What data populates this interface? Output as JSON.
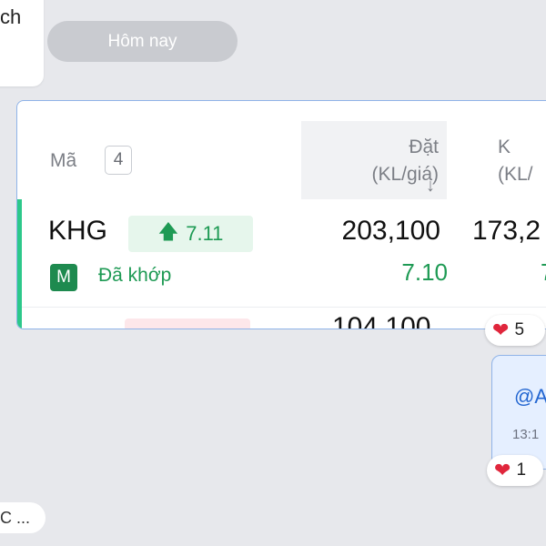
{
  "chat": {
    "top_left_text": "ch",
    "date_divider": "Hôm nay",
    "bottom_left_text": "C ..."
  },
  "orders_card": {
    "header": {
      "symbol_label": "Mã",
      "count": "4",
      "order_col_line1": "Đặt",
      "order_col_line2": "(KL/giá)",
      "sort_icon": "arrow-down-icon",
      "next_col_line1": "K",
      "next_col_line2": "(KL/"
    },
    "rows": [
      {
        "symbol": "KHG",
        "change_icon": "arrow-up-icon",
        "change": "7.11",
        "market_badge": "M",
        "status": "Đã khớp",
        "order_qty": "203,100",
        "order_price": "7.10",
        "matched_qty": "173,2",
        "matched_price": "7"
      }
    ],
    "next_row_qty_peek": "104,100",
    "colors": {
      "accent_green": "#2cc88a",
      "up_green": "#1e9a54",
      "border_blue": "#8fb3e8"
    }
  },
  "reactions": [
    {
      "icon": "heart-icon",
      "count": "5"
    },
    {
      "icon": "heart-icon",
      "count": "1"
    }
  ],
  "sent_message": {
    "mention": "@A",
    "time": "13:1"
  }
}
